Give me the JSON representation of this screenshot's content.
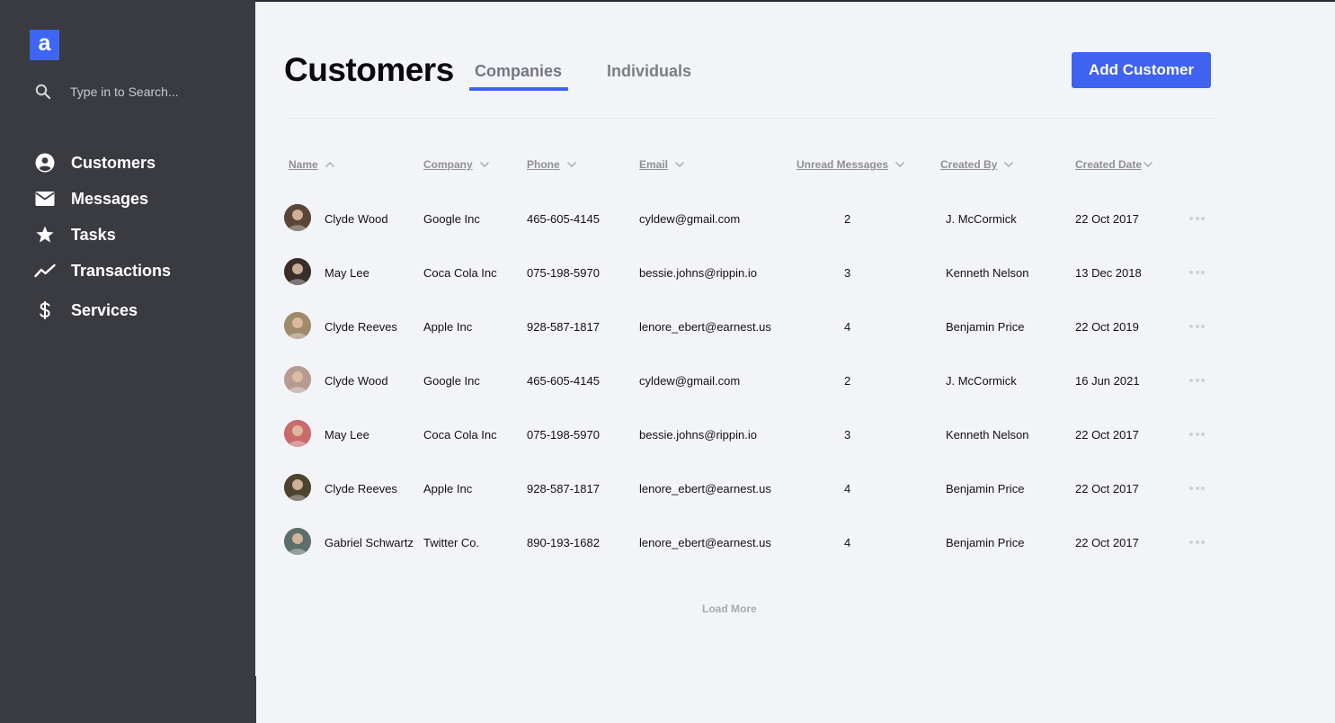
{
  "sidebar": {
    "logo": "a",
    "search_placeholder": "Type in to Search...",
    "items": [
      {
        "label": "Customers",
        "icon": "user-circle-icon"
      },
      {
        "label": "Messages",
        "icon": "envelope-icon"
      },
      {
        "label": "Tasks",
        "icon": "star-icon"
      },
      {
        "label": "Transactions",
        "icon": "trend-line-icon"
      },
      {
        "label": "Services",
        "icon": "dollar-icon"
      }
    ]
  },
  "header": {
    "title": "Customers",
    "tabs": [
      {
        "label": "Companies",
        "active": true
      },
      {
        "label": "Individuals",
        "active": false
      }
    ],
    "add_button": "Add Customer"
  },
  "table": {
    "columns": [
      "Name",
      "Company",
      "Phone",
      "Email",
      "Unread Messages",
      "Created By",
      "Created Date"
    ],
    "rows": [
      {
        "name": "Clyde Wood",
        "company": "Google Inc",
        "phone": "465-605-4145",
        "email": "cyldew@gmail.com",
        "unread": "2",
        "created_by": "J. McCormick",
        "created_date": "22 Oct 2017",
        "avatar_color": "#5a4638"
      },
      {
        "name": "May Lee",
        "company": "Coca Cola Inc",
        "phone": "075-198-5970",
        "email": "bessie.johns@rippin.io",
        "unread": "3",
        "created_by": "Kenneth Nelson",
        "created_date": "13 Dec 2018",
        "avatar_color": "#3a2e28"
      },
      {
        "name": "Clyde Reeves",
        "company": "Apple Inc",
        "phone": "928-587-1817",
        "email": "lenore_ebert@earnest.us",
        "unread": "4",
        "created_by": "Benjamin Price",
        "created_date": "22 Oct 2019",
        "avatar_color": "#a08a6c"
      },
      {
        "name": "Clyde Wood",
        "company": "Google Inc",
        "phone": "465-605-4145",
        "email": "cyldew@gmail.com",
        "unread": "2",
        "created_by": "J. McCormick",
        "created_date": "16 Jun 2021",
        "avatar_color": "#b79a92"
      },
      {
        "name": "May Lee",
        "company": "Coca Cola Inc",
        "phone": "075-198-5970",
        "email": "bessie.johns@rippin.io",
        "unread": "3",
        "created_by": "Kenneth Nelson",
        "created_date": "22 Oct 2017",
        "avatar_color": "#c96a6c"
      },
      {
        "name": "Clyde Reeves",
        "company": "Apple Inc",
        "phone": "928-587-1817",
        "email": "lenore_ebert@earnest.us",
        "unread": "4",
        "created_by": "Benjamin Price",
        "created_date": "22 Oct 2017",
        "avatar_color": "#4c4330"
      },
      {
        "name": "Gabriel Schwartz",
        "company": "Twitter Co.",
        "phone": "890-193-1682",
        "email": "lenore_ebert@earnest.us",
        "unread": "4",
        "created_by": "Benjamin Price",
        "created_date": "22 Oct 2017",
        "avatar_color": "#5d6f6a"
      }
    ],
    "load_more": "Load More"
  },
  "colors": {
    "accent": "#3f62f0",
    "sidebar_bg": "#393b40",
    "main_bg": "#f3f4f8"
  }
}
